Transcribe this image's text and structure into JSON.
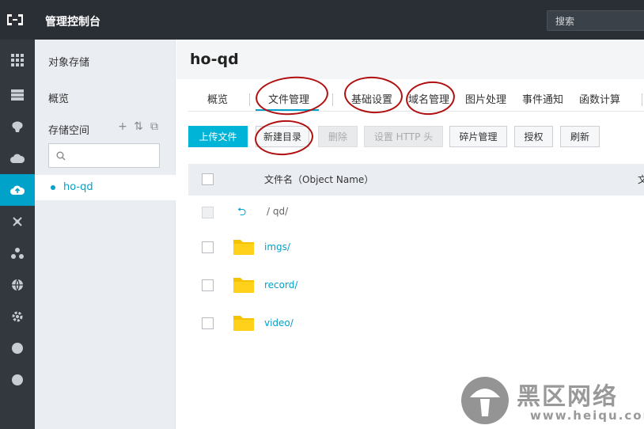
{
  "header": {
    "app_title": "管理控制台",
    "search_label": "搜索"
  },
  "rail": {
    "icons": [
      "grid-icon",
      "database-icon",
      "brain-icon",
      "cloud-icon",
      "cloud-upload-icon",
      "network-icon",
      "cluster-icon",
      "globe-icon",
      "gear-icon",
      "dot-icon",
      "dot-icon"
    ],
    "active_index": 4
  },
  "sidebar": {
    "title": "对象存储",
    "overview": "概览",
    "buckets_label": "存储空间",
    "tools": [
      "+",
      "⇅",
      "⧉"
    ],
    "search_placeholder": "",
    "active_bucket": "ho-qd"
  },
  "main": {
    "bucket_title": "ho-qd",
    "tabs": [
      "概览",
      "文件管理",
      "基础设置",
      "域名管理",
      "图片处理",
      "事件通知",
      "函数计算"
    ],
    "active_tab": "文件管理",
    "toolbar": {
      "upload": "上传文件",
      "new_dir": "新建目录",
      "delete": "删除",
      "http_header": "设置 HTTP 头",
      "fragments": "碎片管理",
      "authorize": "授权",
      "refresh": "刷新"
    },
    "table": {
      "col_name": "文件名（Object Name）",
      "col_more": "文",
      "parent_path": "/  qd/",
      "rows": [
        "imgs/",
        "record/",
        "video/"
      ]
    }
  },
  "watermark": {
    "text": "黑区网络",
    "url": "www.heiqu.com"
  },
  "colors": {
    "accent": "#00a2ca",
    "topbar": "#2a2f35",
    "annotation": "#b01010"
  }
}
